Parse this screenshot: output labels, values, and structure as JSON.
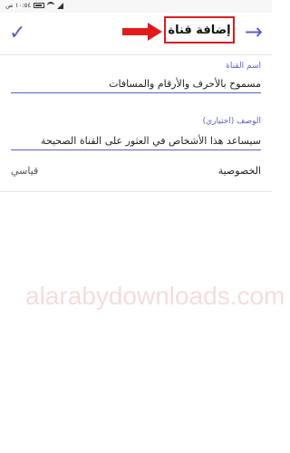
{
  "status": {
    "time": "١٠:٥٤ ص"
  },
  "header": {
    "title": "إضافة قناة",
    "confirm_icon": "check-icon",
    "back_icon": "arrow-right-icon"
  },
  "form": {
    "name_label": "اسم القناة",
    "name_value": "مسموح بالأحرف والأرقام والمسافات",
    "description_label": "الوصف (اختياري)",
    "description_value": "سيساعد هذا الأشخاص في العثور على القناة الصحيحة",
    "privacy_label": "الخصوصية",
    "privacy_value": "قياسي"
  },
  "watermark": "alarabydownloads.com",
  "colors": {
    "accent": "#5b5fc7",
    "annotation": "#e11b1b"
  }
}
